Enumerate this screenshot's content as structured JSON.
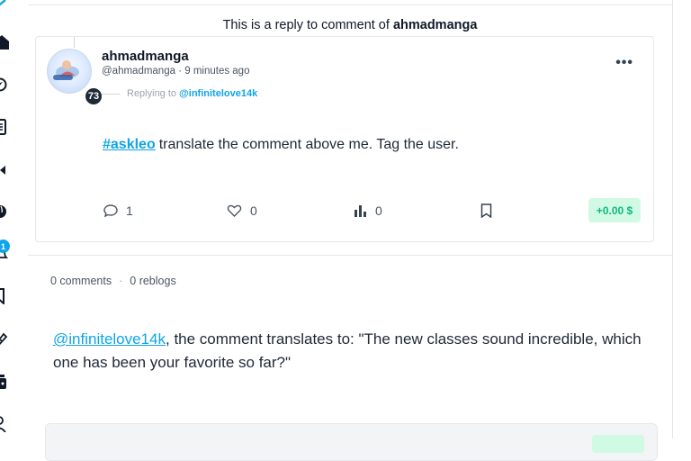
{
  "header": {
    "prefix": "This is a reply to comment of",
    "author": "ahmadmanga"
  },
  "sidebar": {
    "notification_count": "1",
    "icons": [
      "home-icon",
      "explore-icon",
      "posts-icon",
      "video-icon",
      "globe-icon",
      "notifications-icon",
      "bookmark-icon",
      "tag-icon",
      "wallet-icon",
      "profile-icon"
    ]
  },
  "post": {
    "author": {
      "display_name": "ahmadmanga",
      "handle": "@ahmadmanga",
      "time": "9 minutes ago",
      "reputation": "73"
    },
    "replying_to": {
      "label": "Replying to",
      "user": "@infinitelove14k"
    },
    "hashtag": "#askleo",
    "text": "translate the comment above me. Tag the user.",
    "actions": {
      "comments": "1",
      "likes": "0",
      "votes": "0"
    },
    "payout": "+0.00 $",
    "more": "•••"
  },
  "stats": {
    "comments": "0 comments",
    "separator": "·",
    "reblogs": "0 reblogs"
  },
  "reply": {
    "mention": "@infinitelove14k",
    "text": ", the comment translates to: \"The new classes sound incredible, which one has been your favorite so far?\""
  },
  "colors": {
    "accent": "#0ea5e9",
    "payout_bg": "#d1fae5",
    "payout_text": "#10b981"
  }
}
